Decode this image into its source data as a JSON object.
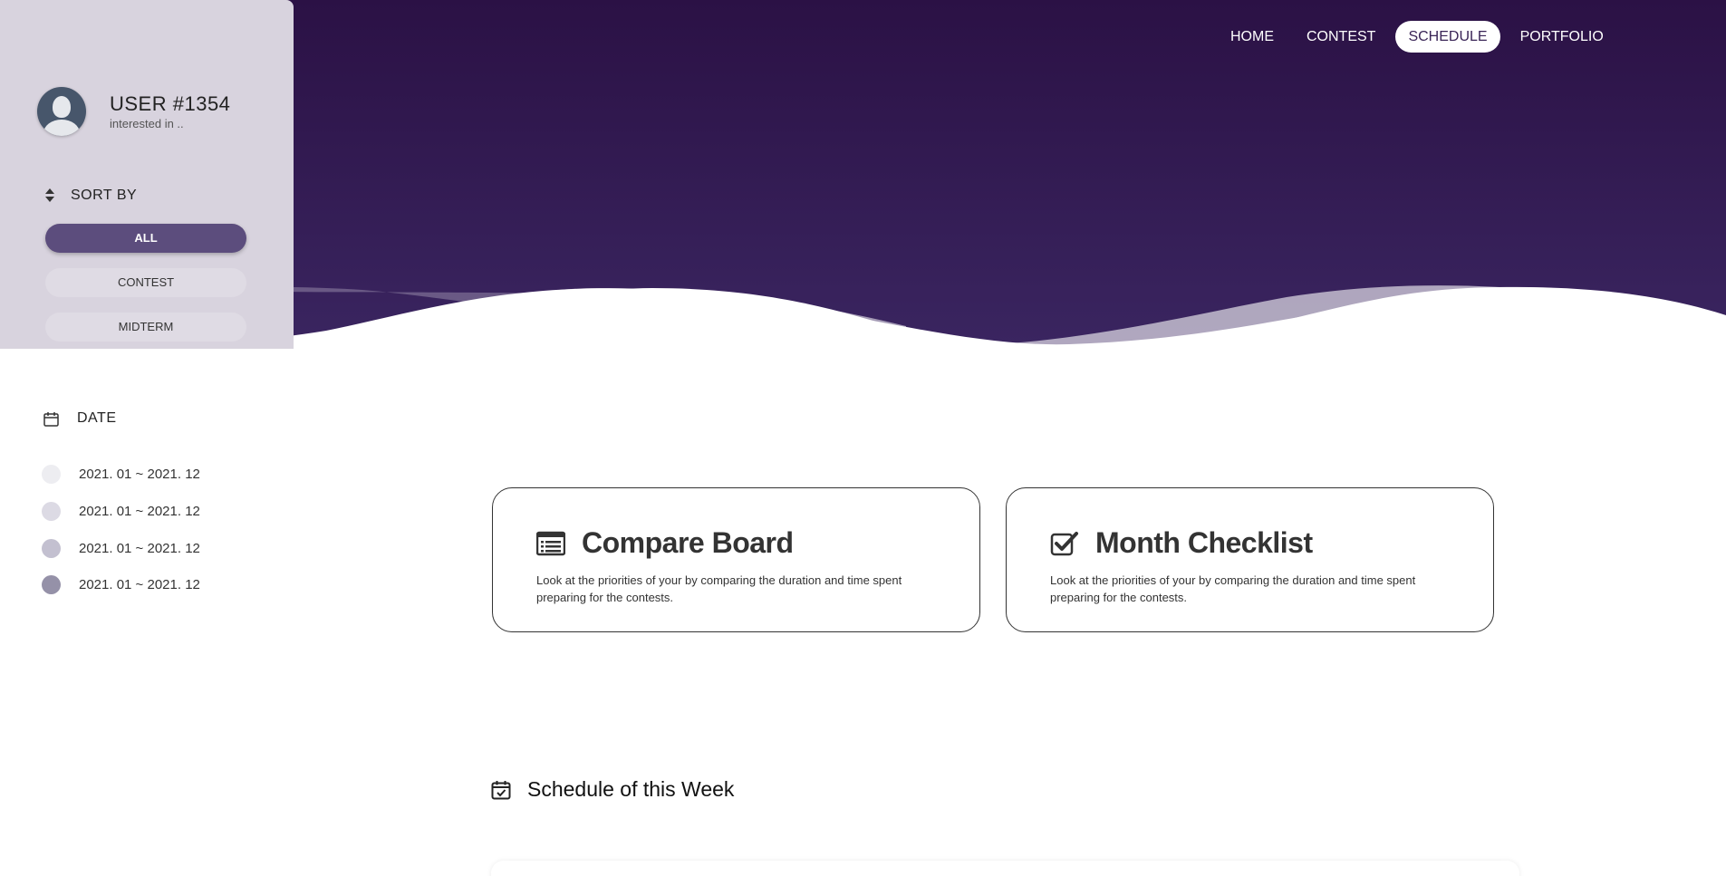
{
  "nav": {
    "items": [
      {
        "label": "HOME"
      },
      {
        "label": "CONTEST"
      },
      {
        "label": "SCHEDULE"
      },
      {
        "label": "PORTFOLIO"
      }
    ],
    "active": "SCHEDULE"
  },
  "profile": {
    "name": "USER #1354",
    "subtitle": "interested in .."
  },
  "sort": {
    "label": "SORT BY",
    "options": [
      {
        "label": "ALL",
        "active": true
      },
      {
        "label": "CONTEST",
        "active": false
      },
      {
        "label": "MIDTERM",
        "active": false
      }
    ]
  },
  "date": {
    "label": "DATE",
    "items": [
      {
        "label": "2021. 01 ~ 2021. 12",
        "color": "#ededf1"
      },
      {
        "label": "2021. 01 ~ 2021. 12",
        "color": "#dcdae4"
      },
      {
        "label": "2021. 01 ~ 2021. 12",
        "color": "#c3c0d0"
      },
      {
        "label": "2021. 01 ~ 2021. 12",
        "color": "#9591a8"
      }
    ]
  },
  "cards": [
    {
      "title": "Compare Board",
      "icon": "list-alt-icon",
      "description": "Look at the priorities of your by comparing the duration and time spent preparing for the contests."
    },
    {
      "title": "Month Checklist",
      "icon": "check-square-icon",
      "description": "Look at the priorities of your by comparing the duration and time spent preparing for the contests."
    }
  ],
  "week": {
    "title": "Schedule of this Week",
    "icon": "calendar-check-icon"
  },
  "colors": {
    "hero_top": "#2b1145",
    "hero_bottom": "#3a2560",
    "sidebar_bg": "#d8d3de",
    "active_filter": "#5c4d7d",
    "text": "#333333"
  }
}
